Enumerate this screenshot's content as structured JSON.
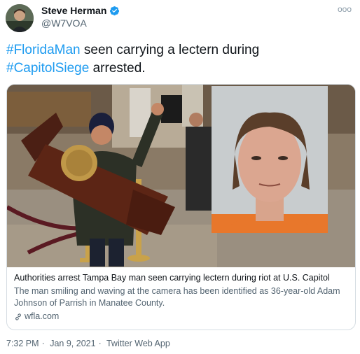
{
  "author": {
    "display_name": "Steve Herman",
    "handle": "@W7VOA",
    "verified": true
  },
  "more_icon": "ooo",
  "tweet": {
    "hashtag1": "#FloridaMan",
    "text1": " seen carrying a lectern during ",
    "hashtag2": "#CapitolSiege",
    "text2": " arrested."
  },
  "card": {
    "title": "Authorities arrest Tampa Bay man seen carrying lectern during riot at U.S. Capitol",
    "description": "The man smiling and waving at the camera has been identified as 36-year-old Adam Johnson of Parrish in Manatee County.",
    "domain": "wfla.com"
  },
  "meta": {
    "time": "7:32 PM",
    "date": "Jan 9, 2021",
    "source": "Twitter Web App",
    "separator": "·"
  },
  "colors": {
    "link": "#1d9bf0",
    "text": "#0f1419",
    "secondary": "#536471"
  }
}
